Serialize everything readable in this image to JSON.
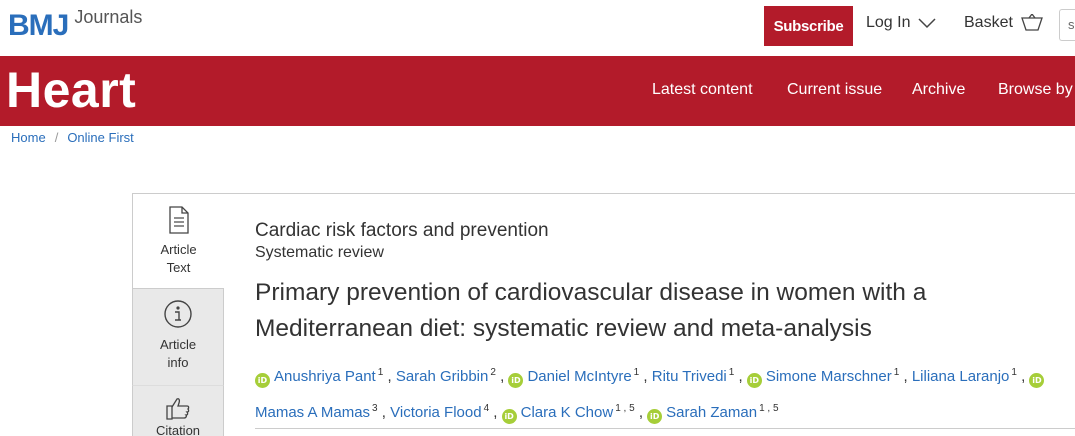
{
  "header": {
    "logo_text": "BMJ",
    "logo_subtext": "Journals",
    "subscribe_label": "Subscribe",
    "login_label": "Log In",
    "basket_label": "Basket",
    "search_partial": "s"
  },
  "nav": {
    "brand": "Heart",
    "items": [
      {
        "label": "Latest content"
      },
      {
        "label": "Current issue"
      },
      {
        "label": "Archive"
      },
      {
        "label": "Browse by c"
      }
    ]
  },
  "breadcrumb": {
    "items": [
      {
        "label": "Home"
      },
      {
        "label": "Online First"
      }
    ],
    "separator": "/"
  },
  "side_tabs": [
    {
      "line1": "Article",
      "line2": "Text",
      "icon": "document-icon"
    },
    {
      "line1": "Article",
      "line2": "info",
      "icon": "info-icon"
    },
    {
      "line1": "Citation",
      "line2": "",
      "icon": "thumbs-up-icon"
    }
  ],
  "article": {
    "section": "Cardiac risk factors and prevention",
    "type": "Systematic review",
    "title_line1": "Primary prevention of cardiovascular disease in women with a",
    "title_line2": "Mediterranean diet: systematic review and meta-analysis",
    "orcid_badge": "iD",
    "authors": [
      {
        "name": "Anushriya Pant",
        "aff": "1",
        "orcid": true
      },
      {
        "name": "Sarah Gribbin",
        "aff": "2",
        "orcid": false
      },
      {
        "name": "Daniel McIntyre",
        "aff": "1",
        "orcid": true
      },
      {
        "name": "Ritu Trivedi",
        "aff": "1",
        "orcid": false
      },
      {
        "name": "Simone Marschner",
        "aff": "1",
        "orcid": true
      },
      {
        "name": "Liliana Laranjo",
        "aff": "1",
        "orcid": false
      },
      {
        "name": "Mamas A Mamas",
        "aff": "3",
        "orcid": true
      },
      {
        "name": "Victoria Flood",
        "aff": "4",
        "orcid": false
      },
      {
        "name": "Clara K Chow",
        "aff": "1 ,  5",
        "orcid": true
      },
      {
        "name": "Sarah Zaman",
        "aff": "1 ,  5",
        "orcid": true
      }
    ]
  },
  "colors": {
    "brand_red": "#b31b2a",
    "link_blue": "#2a6ebb",
    "orcid_green": "#a6ce39"
  }
}
